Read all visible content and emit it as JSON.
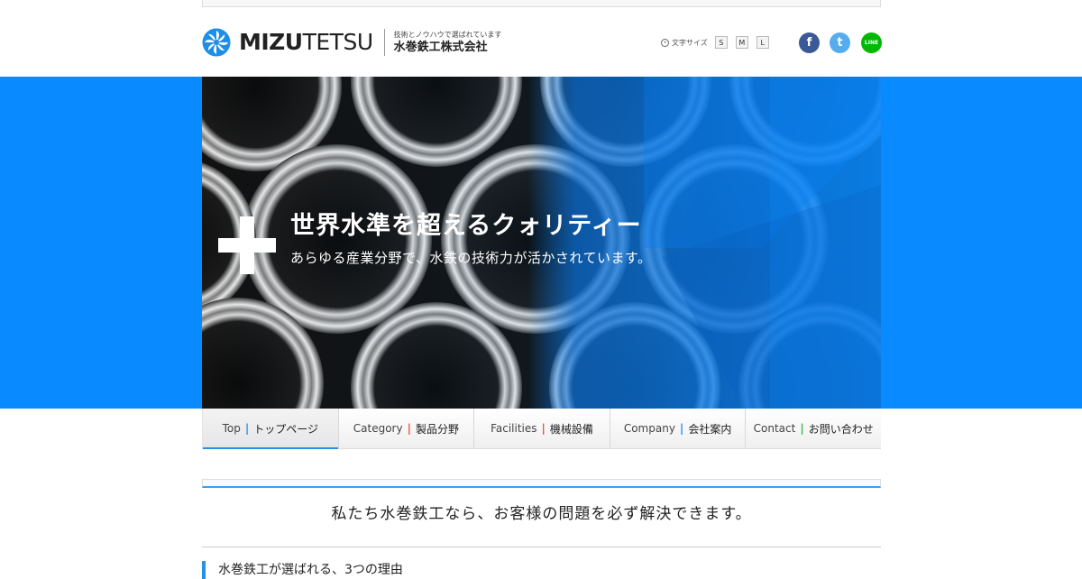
{
  "header": {
    "logo_latin_bold": "MIZU",
    "logo_latin_light": "TETSU",
    "tagline": "技術とノウハウで選ばれています",
    "company_name": "水巻鉄工株式会社"
  },
  "font_size": {
    "label": "文字サイズ",
    "options": [
      "S",
      "M",
      "L"
    ]
  },
  "social": {
    "facebook": "f",
    "twitter": "t",
    "line": "LINE"
  },
  "hero": {
    "title": "世界水準を超えるクォリティー",
    "subtitle": "あらゆる産業分野で、水鉄の技術力が活かされています。"
  },
  "nav": [
    {
      "en": "Top",
      "sep": "|",
      "ja": "トップページ",
      "sep_color": "#2a8fe8"
    },
    {
      "en": "Category",
      "sep": "|",
      "ja": "製品分野",
      "sep_color": "#e8553d"
    },
    {
      "en": "Facilities",
      "sep": "|",
      "ja": "機械設備",
      "sep_color": "#e8553d"
    },
    {
      "en": "Company",
      "sep": "|",
      "ja": "会社案内",
      "sep_color": "#2a8fe8"
    },
    {
      "en": "Contact",
      "sep": "|",
      "ja": "お問い合わせ",
      "sep_color": "#3bb54a"
    }
  ],
  "main": {
    "lead": "私たち水巻鉄工なら、お客様の問題を必ず解決できます。",
    "section_heading": "水巻鉄工が選ばれる、3つの理由"
  },
  "colors": {
    "accent_blue": "#0a8aff",
    "nav_active_underline": "#2a8fe8"
  }
}
